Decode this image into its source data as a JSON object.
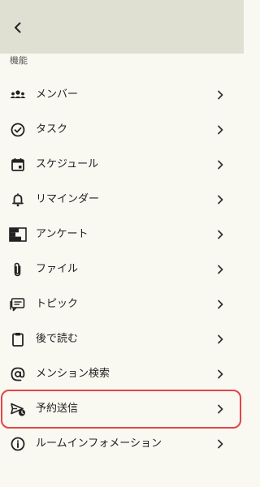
{
  "header": {
    "back_icon": "chevron-left-icon"
  },
  "section": {
    "title": "機能"
  },
  "menu": {
    "items": [
      {
        "label": "メンバー",
        "icon": "members-icon"
      },
      {
        "label": "タスク",
        "icon": "task-check-icon"
      },
      {
        "label": "スケジュール",
        "icon": "calendar-icon"
      },
      {
        "label": "リマインダー",
        "icon": "bell-icon"
      },
      {
        "label": "アンケート",
        "icon": "survey-icon"
      },
      {
        "label": "ファイル",
        "icon": "paperclip-icon"
      },
      {
        "label": "トピック",
        "icon": "topic-icon"
      },
      {
        "label": "後で読む",
        "icon": "clipboard-icon"
      },
      {
        "label": "メンション検索",
        "icon": "at-sign-icon"
      },
      {
        "label": "予約送信",
        "icon": "scheduled-send-icon"
      },
      {
        "label": "ルームインフォメーション",
        "icon": "info-icon"
      }
    ],
    "highlighted_item": "予約送信"
  },
  "colors": {
    "header_bg": "#dfe0d1",
    "page_bg": "#f9f8f1",
    "highlight_border": "#e2454a"
  }
}
